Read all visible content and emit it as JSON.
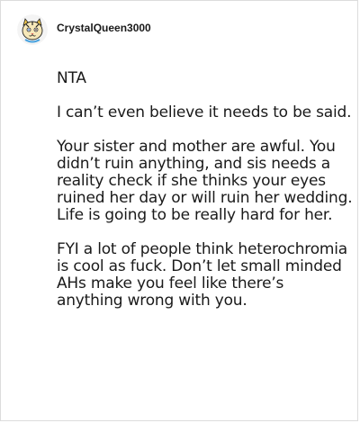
{
  "comment": {
    "username": "CrystalQueen3000",
    "avatar": "tiger-avatar-icon",
    "paragraphs": [
      "NTA",
      "I can’t even believe it needs to be said.",
      "Your sister and mother are awful. You didn’t ruin anything, and sis needs a reality check if she thinks your eyes ruined her day or will ruin her wedding. Life is going to be really hard for her.",
      "FYI a lot of people think heterochromia is cool as fuck. Don’t let small minded AHs make you feel like there’s anything wrong with you."
    ]
  },
  "colors": {
    "text": "#1a1a1a",
    "border": "#dcdcdc",
    "background": "#ffffff"
  }
}
